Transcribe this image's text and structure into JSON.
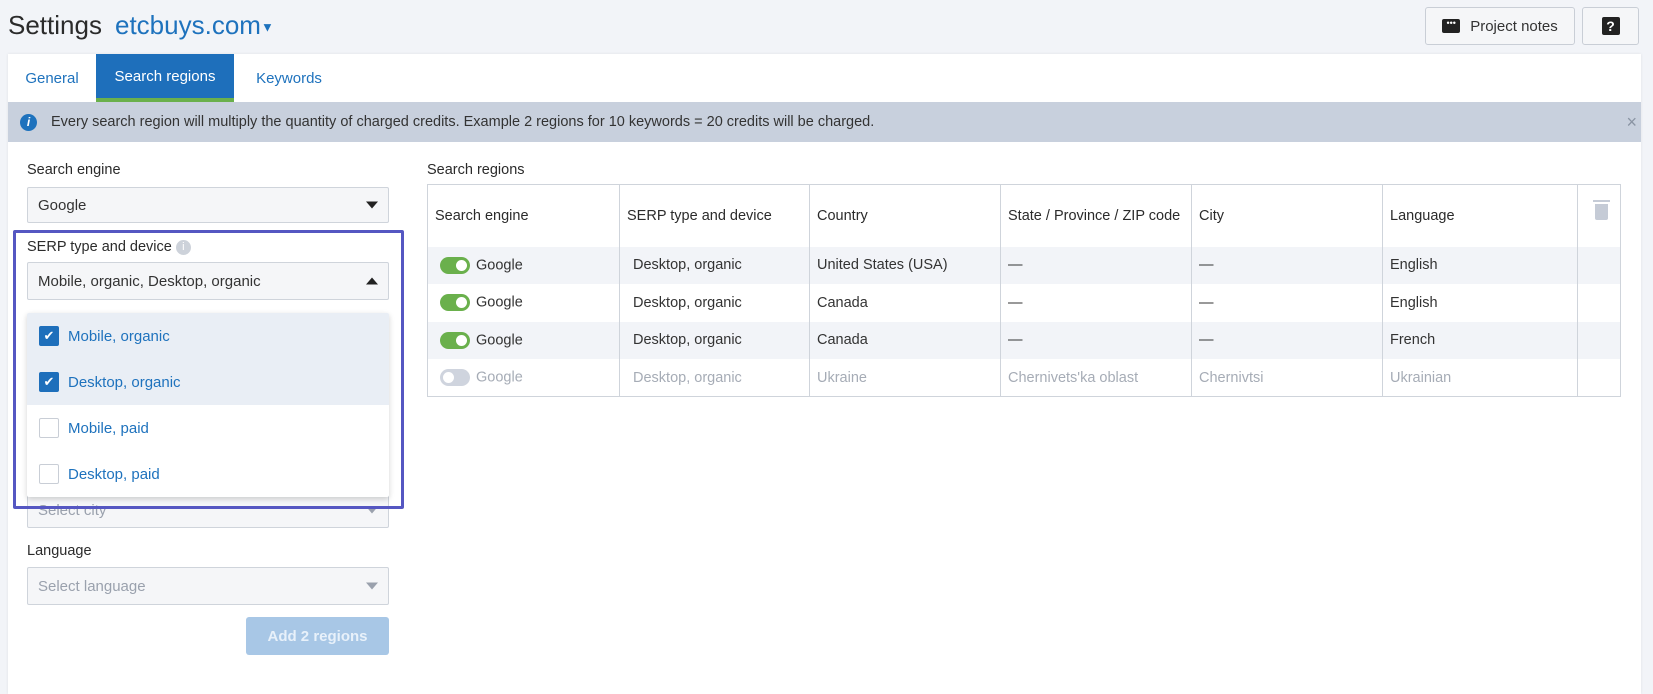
{
  "header": {
    "title": "Settings",
    "project": "etcbuys.com",
    "project_notes": "Project notes",
    "help": "?"
  },
  "tabs": [
    {
      "label": "General"
    },
    {
      "label": "Search regions",
      "active": true
    },
    {
      "label": "Keywords"
    }
  ],
  "info": {
    "text": "Every search region will multiply the quantity of charged credits. Example 2 regions for 10 keywords = 20 credits will be charged.",
    "close": "×"
  },
  "form": {
    "search_engine_label": "Search engine",
    "search_engine_value": "Google",
    "serp_label": "SERP type and device",
    "serp_value": "Mobile, organic, Desktop, organic",
    "serp_options": [
      {
        "label": "Mobile, organic",
        "checked": true
      },
      {
        "label": "Desktop, organic",
        "checked": true
      },
      {
        "label": "Mobile, paid",
        "checked": false
      },
      {
        "label": "Desktop, paid",
        "checked": false
      }
    ],
    "city_placeholder": "Select city",
    "language_label": "Language",
    "language_placeholder": "Select language",
    "add_button": "Add 2 regions"
  },
  "regions": {
    "title": "Search regions",
    "columns": [
      "Search engine",
      "SERP type and device",
      "Country",
      "State / Province / ZIP code",
      "City",
      "Language"
    ],
    "rows": [
      {
        "enabled": true,
        "engine": "Google",
        "serp": "Desktop, organic",
        "country": "United States (USA)",
        "state": "—",
        "city": "—",
        "language": "English"
      },
      {
        "enabled": true,
        "engine": "Google",
        "serp": "Desktop, organic",
        "country": "Canada",
        "state": "—",
        "city": "—",
        "language": "English"
      },
      {
        "enabled": true,
        "engine": "Google",
        "serp": "Desktop, organic",
        "country": "Canada",
        "state": "—",
        "city": "—",
        "language": "French"
      },
      {
        "enabled": false,
        "engine": "Google",
        "serp": "Desktop, organic",
        "country": "Ukraine",
        "state": "Chernivets'ka oblast",
        "city": "Chernivtsi",
        "language": "Ukrainian"
      }
    ]
  },
  "colors": {
    "accent": "#1e6fbb",
    "toggle_on": "#6ab04c",
    "highlight": "#5557c2"
  }
}
